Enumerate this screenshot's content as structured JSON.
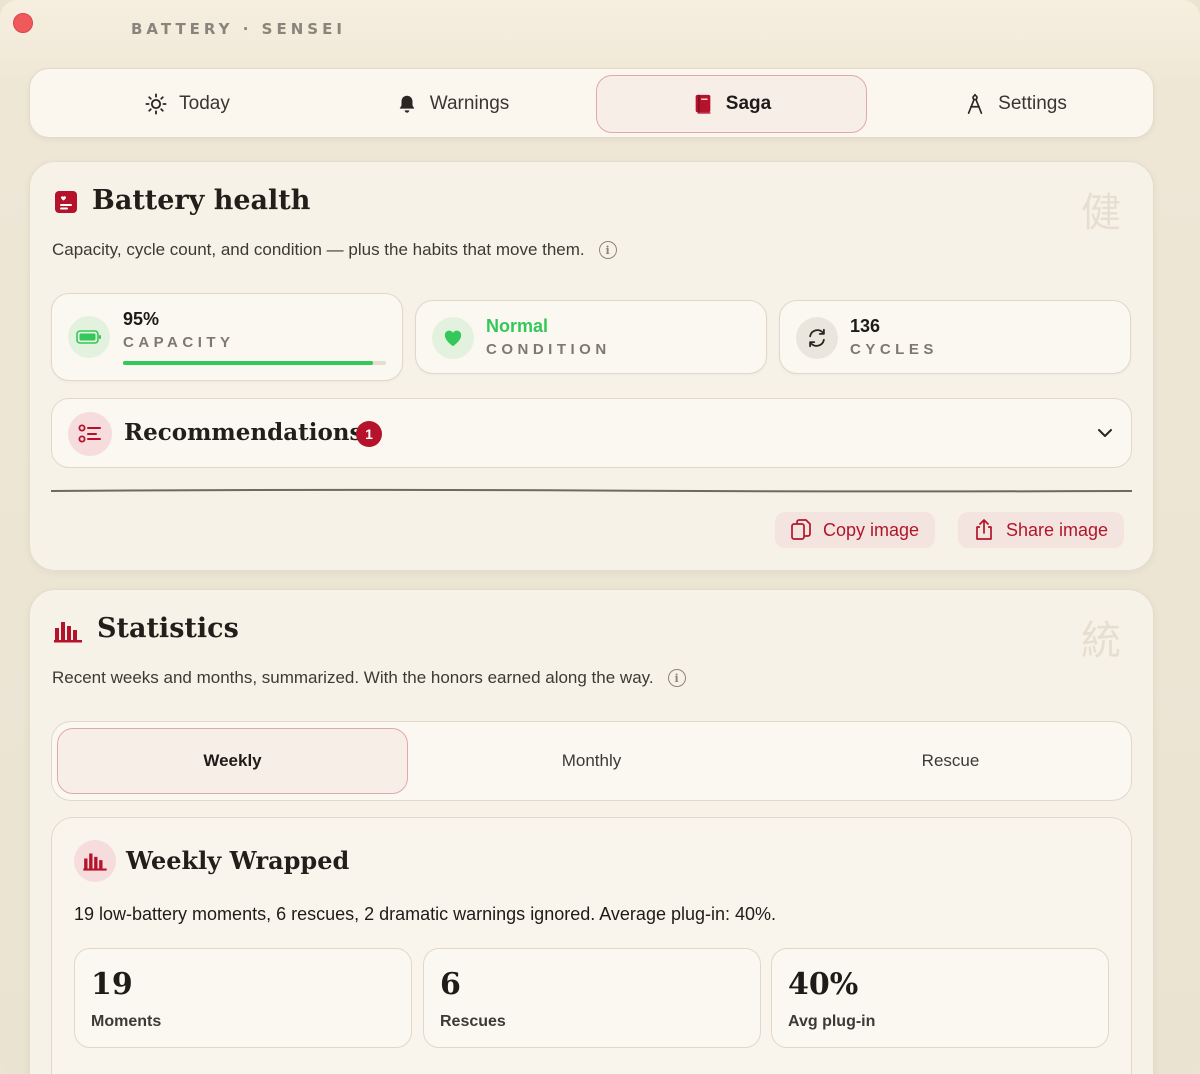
{
  "app": {
    "title": "BATTERY · SENSEI"
  },
  "tabs": [
    {
      "label": "Today",
      "icon": "sun-icon",
      "active": false
    },
    {
      "label": "Warnings",
      "icon": "bell-icon",
      "active": false
    },
    {
      "label": "Saga",
      "icon": "book-icon",
      "active": true
    },
    {
      "label": "Settings",
      "icon": "compass-icon",
      "active": false
    }
  ],
  "health": {
    "title": "Battery health",
    "kanji": "健",
    "subtitle": "Capacity, cycle count, and condition — plus the habits that move them.",
    "capacity": {
      "value": "95%",
      "label": "CAPACITY",
      "fraction": 0.95
    },
    "condition": {
      "value": "Normal",
      "label": "CONDITION"
    },
    "cycles": {
      "value": "136",
      "label": "CYCLES"
    },
    "recommendations": {
      "title": "Recommendations",
      "count": "1"
    },
    "copy_label": "Copy image",
    "share_label": "Share image"
  },
  "statistics": {
    "title": "Statistics",
    "kanji": "統",
    "subtitle": "Recent weeks and months, summarized. With the honors earned along the way.",
    "segments": [
      "Weekly",
      "Monthly",
      "Rescue"
    ],
    "wrapped": {
      "title": "Weekly Wrapped",
      "summary": "19 low-battery moments, 6 rescues, 2 dramatic warnings ignored. Average plug-in: 40%.",
      "metrics": [
        {
          "value": "19",
          "label": "Moments"
        },
        {
          "value": "6",
          "label": "Rescues"
        },
        {
          "value": "40%",
          "label": "Avg plug-in"
        }
      ]
    }
  },
  "colors": {
    "accent": "#b5122b",
    "success": "#34c759",
    "background": "#ebe3d2"
  }
}
